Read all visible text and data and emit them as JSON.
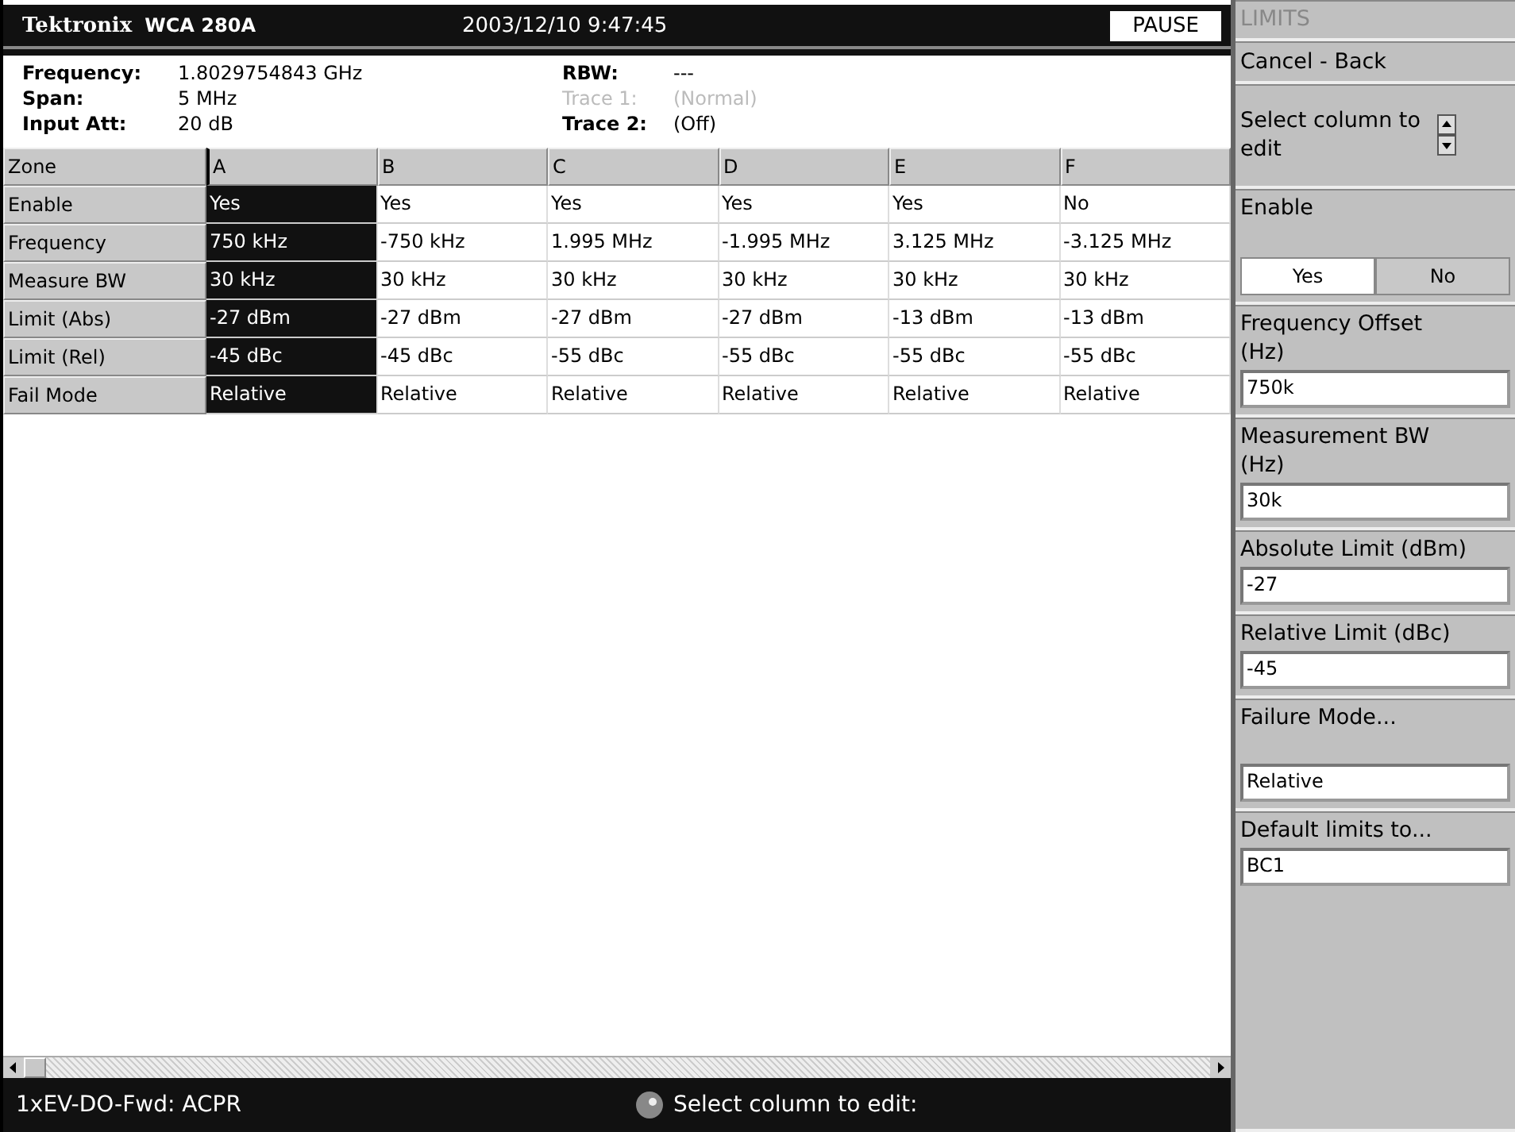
{
  "header": {
    "brand": "Tektronix",
    "model": "WCA 280A",
    "datetime": "2003/12/10 9:47:45",
    "status": "PAUSE"
  },
  "info_left": [
    {
      "label": "Frequency:",
      "value": "1.8029754843 GHz",
      "disabled": false
    },
    {
      "label": "Span:",
      "value": "5 MHz",
      "disabled": false
    },
    {
      "label": "Input Att:",
      "value": "20 dB",
      "disabled": false
    }
  ],
  "info_right": [
    {
      "label": "RBW:",
      "value": "---",
      "disabled": false
    },
    {
      "label": "Trace 1:",
      "value": "(Normal)",
      "disabled": true
    },
    {
      "label": "Trace 2:",
      "value": "(Off)",
      "disabled": false
    }
  ],
  "table": {
    "corner": "Zone",
    "columns": [
      {
        "label": "A",
        "selected": true
      },
      {
        "label": "B",
        "selected": false
      },
      {
        "label": "C",
        "selected": false
      },
      {
        "label": "D",
        "selected": false
      },
      {
        "label": "E",
        "selected": false
      },
      {
        "label": "F",
        "selected": false
      }
    ],
    "rows": [
      {
        "label": "Enable",
        "cells": [
          "Yes",
          "Yes",
          "Yes",
          "Yes",
          "Yes",
          "No"
        ]
      },
      {
        "label": "Frequency",
        "cells": [
          "750 kHz",
          "-750 kHz",
          "1.995 MHz",
          "-1.995 MHz",
          "3.125 MHz",
          "-3.125 MHz"
        ]
      },
      {
        "label": "Measure BW",
        "cells": [
          "30 kHz",
          "30 kHz",
          "30 kHz",
          "30 kHz",
          "30 kHz",
          "30 kHz"
        ]
      },
      {
        "label": "Limit (Abs)",
        "cells": [
          "-27 dBm",
          "-27 dBm",
          "-27 dBm",
          "-27 dBm",
          "-13 dBm",
          "-13 dBm"
        ]
      },
      {
        "label": "Limit (Rel)",
        "cells": [
          "-45 dBc",
          "-45 dBc",
          "-55 dBc",
          "-55 dBc",
          "-55 dBc",
          "-55 dBc"
        ]
      },
      {
        "label": "Fail Mode",
        "cells": [
          "Relative",
          "Relative",
          "Relative",
          "Relative",
          "Relative",
          "Relative"
        ]
      }
    ]
  },
  "status_bar": {
    "mode": "1xEV-DO-Fwd: ACPR",
    "prompt": "Select column to edit:"
  },
  "side_menu": [
    {
      "kind": "title",
      "label": "LIMITS",
      "disabled": true
    },
    {
      "kind": "button",
      "label": "Cancel - Back"
    },
    {
      "kind": "spin",
      "label": "Select column to edit"
    },
    {
      "kind": "toggle",
      "label": "Enable",
      "options": [
        {
          "label": "Yes",
          "selected": true
        },
        {
          "label": "No",
          "selected": false
        }
      ]
    },
    {
      "kind": "field",
      "label": "Frequency Offset (Hz)",
      "value": "750k"
    },
    {
      "kind": "field",
      "label": "Measurement BW (Hz)",
      "value": "30k"
    },
    {
      "kind": "field",
      "label": "Absolute Limit (dBm)",
      "value": "-27"
    },
    {
      "kind": "field",
      "label": "Relative Limit (dBc)",
      "value": "-45"
    },
    {
      "kind": "select",
      "label": "Failure Mode...",
      "value": "Relative"
    },
    {
      "kind": "field",
      "label": "Default limits to...",
      "value": "BC1"
    }
  ]
}
